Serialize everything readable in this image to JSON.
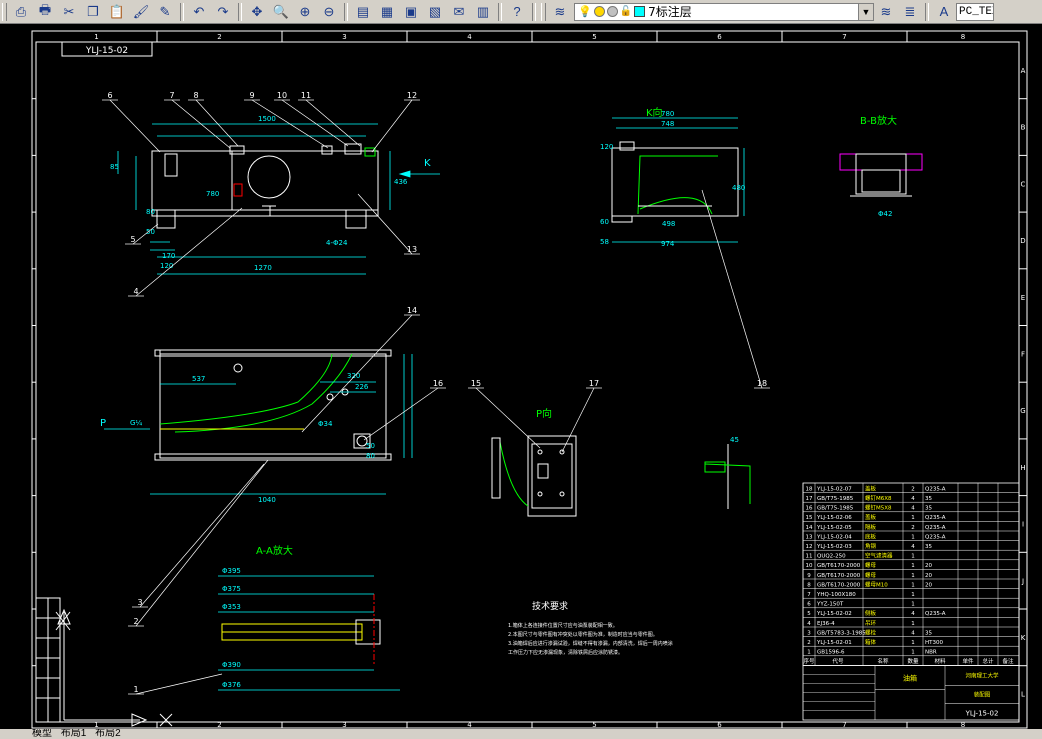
{
  "toolbar": {
    "icons": [
      "cut-icon",
      "copy-icon",
      "paste-icon",
      "match-properties-icon",
      "undo-icon",
      "redo-icon",
      "pan-icon",
      "zoom-realtime-icon",
      "zoom-window-icon",
      "zoom-previous-icon",
      "properties-icon",
      "design-center-icon",
      "tool-palettes-icon",
      "markup-icon",
      "calculator-icon",
      "help-icon",
      "layer-manager-icon",
      "layer-previous-icon",
      "text-style-icon"
    ],
    "layer_name": "7标注层",
    "text_style": "PC_TEX"
  },
  "drawing": {
    "top_title_block": "YLJ-15-02",
    "zone_columns": [
      "1",
      "2",
      "3",
      "4",
      "5",
      "6",
      "7",
      "8"
    ],
    "zone_rows": [
      "A",
      "B",
      "C",
      "D",
      "E",
      "F",
      "G",
      "H",
      "I",
      "J",
      "K",
      "L"
    ],
    "view_k": "K向",
    "view_bb": "B-B放大",
    "view_p": "P向",
    "view_aa": "A-A放大",
    "tech_title": "技术要求",
    "tech_lines": [
      "1.箱体上各连接件位置尺寸应与油泵装配相一致。",
      "2.本图尺寸与零件图有冲突处以零件图为准，制造时应当与零件图。",
      "3.油箱焊后应进行渗漏试验，焊缝不得有渗漏，内部清洗，焊后一周内喷涂",
      "  工作压力下应无渗漏现象，清除铁屑后应涂防锈漆。"
    ],
    "direction_k": "K",
    "direction_p": "P",
    "dims_front": [
      "1500",
      "1270",
      "780",
      "436",
      "4-Φ24",
      "120",
      "170",
      "80",
      "50",
      "85"
    ],
    "dims_top": [
      "537",
      "1040",
      "320",
      "226",
      "Φ34",
      "80",
      "50",
      "G¼"
    ],
    "dims_k": [
      "780",
      "748",
      "480",
      "974",
      "498",
      "120",
      "60",
      "58"
    ],
    "dims_bb": [
      "Φ42"
    ],
    "dims_aa": [
      "Φ395",
      "Φ375",
      "Φ353",
      "Φ390",
      "Φ376"
    ],
    "dims_detail": [
      "45"
    ],
    "balloons": [
      "1",
      "2",
      "3",
      "4",
      "5",
      "6",
      "7",
      "8",
      "9",
      "10",
      "11",
      "12",
      "13",
      "14",
      "15",
      "16",
      "17",
      "18"
    ],
    "bom": [
      {
        "no": "18",
        "code": "YLJ-15-02-07",
        "name": "盖板",
        "qty": "2",
        "mat": "Q235-A"
      },
      {
        "no": "17",
        "code": "GB/T75-1985",
        "name": "螺钉M6X8",
        "qty": "4",
        "mat": "35"
      },
      {
        "no": "16",
        "code": "GB/T75-1985",
        "name": "螺钉M5X8",
        "qty": "4",
        "mat": "35"
      },
      {
        "no": "15",
        "code": "YLJ-15-02-06",
        "name": "盖板",
        "qty": "1",
        "mat": "Q235-A"
      },
      {
        "no": "14",
        "code": "YLJ-15-02-05",
        "name": "隔板",
        "qty": "2",
        "mat": "Q235-A"
      },
      {
        "no": "13",
        "code": "YLJ-15-02-04",
        "name": "底板",
        "qty": "1",
        "mat": "Q235-A"
      },
      {
        "no": "12",
        "code": "YLJ-15-02-03",
        "name": "角钢",
        "qty": "4",
        "mat": "35"
      },
      {
        "no": "11",
        "code": "QUQ2-250",
        "name": "空气滤清器",
        "qty": "1",
        "mat": ""
      },
      {
        "no": "10",
        "code": "GB/T6170-2000",
        "name": "螺母",
        "qty": "1",
        "mat": "20"
      },
      {
        "no": "9",
        "code": "GB/T6170-2000",
        "name": "螺母",
        "qty": "1",
        "mat": "20"
      },
      {
        "no": "8",
        "code": "GB/T6170-2000",
        "name": "螺母M10",
        "qty": "1",
        "mat": "20"
      },
      {
        "no": "7",
        "code": "YHQ-100X180",
        "name": "",
        "qty": "1",
        "mat": ""
      },
      {
        "no": "6",
        "code": "YYZ-150T",
        "name": "",
        "qty": "1",
        "mat": ""
      },
      {
        "no": "5",
        "code": "YLJ-15-02-02",
        "name": "侧板",
        "qty": "4",
        "mat": "Q235-A"
      },
      {
        "no": "4",
        "code": "EJ36-4",
        "name": "吊环",
        "qty": "1",
        "mat": ""
      },
      {
        "no": "3",
        "code": "GB/T5783-3-1985",
        "name": "螺栓",
        "qty": "4",
        "mat": "35"
      },
      {
        "no": "2",
        "code": "YLJ-15-02-01",
        "name": "箱体",
        "qty": "1",
        "mat": "HT300"
      },
      {
        "no": "1",
        "code": "GB1596-6",
        "name": "",
        "qty": "1",
        "mat": "NBR"
      }
    ],
    "bom_header": [
      "序号",
      "代号",
      "名称",
      "数量",
      "材料",
      "单件",
      "总计",
      "备注"
    ],
    "title_name": "油箱",
    "title_school": "河南理工大学",
    "title_drawing_no": "YLJ-15-02",
    "title_unit": "装配图"
  },
  "layout_tabs": [
    "模型",
    "布局1",
    "布局2"
  ],
  "colors": {
    "lines": "#00ffff",
    "green": "#00ff00",
    "yellow": "#ffff00",
    "white": "#ffffff",
    "red": "#ff0000",
    "magenta": "#ff00ff",
    "toolbar": "#d4d0c8"
  }
}
